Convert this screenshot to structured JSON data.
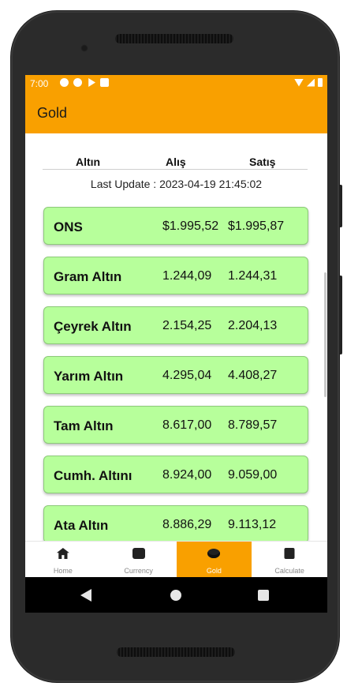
{
  "status_bar": {
    "time": "7:00"
  },
  "app_bar": {
    "title": "Gold"
  },
  "table": {
    "headers": [
      "Altın",
      "Alış",
      "Satış"
    ],
    "last_update": "Last Update : 2023-04-19 21:45:02",
    "rows": [
      {
        "name": "ONS",
        "buy": "$1.995,52",
        "sell": "$1.995,87"
      },
      {
        "name": "Gram Altın",
        "buy": "1.244,09",
        "sell": "1.244,31"
      },
      {
        "name": "Çeyrek Altın",
        "buy": "2.154,25",
        "sell": "2.204,13"
      },
      {
        "name": "Yarım Altın",
        "buy": "4.295,04",
        "sell": "4.408,27"
      },
      {
        "name": "Tam Altın",
        "buy": "8.617,00",
        "sell": "8.789,57"
      },
      {
        "name": "Cumh. Altını",
        "buy": "8.924,00",
        "sell": "9.059,00"
      },
      {
        "name": "Ata Altın",
        "buy": "8.886,29",
        "sell": "9.113,12"
      }
    ]
  },
  "bottom_nav": {
    "items": [
      {
        "label": "Home",
        "icon": "home-icon"
      },
      {
        "label": "Currency",
        "icon": "wallet-icon"
      },
      {
        "label": "Gold",
        "icon": "gold-coin-icon"
      },
      {
        "label": "Calculate",
        "icon": "calculator-icon"
      }
    ],
    "active": "Gold"
  },
  "colors": {
    "accent": "#f9a000",
    "card": "#b7ff9b"
  }
}
